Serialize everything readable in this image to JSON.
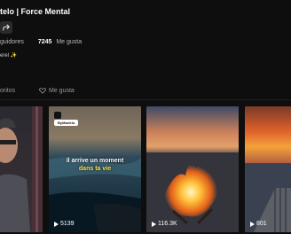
{
  "profile": {
    "title": "telo | Force Mental",
    "followers_label": "guidores",
    "likes_count": "7245",
    "likes_label": "Me gusta",
    "bio": "erel ✨"
  },
  "tabs": [
    {
      "label": "oritos",
      "icon": "bookmark-icon"
    },
    {
      "label": "Me gusta",
      "icon": "heart-icon"
    }
  ],
  "videos": [
    {
      "views": "",
      "theme": "person"
    },
    {
      "views": "5139",
      "theme": "ocean",
      "author_tag": "ByMartelo",
      "caption_line1": "il arrive un moment",
      "caption_line2": "dans ta vie"
    },
    {
      "views": "116.3K",
      "theme": "fire"
    },
    {
      "views": "801",
      "theme": "sunset"
    }
  ],
  "colors": {
    "background": "#0e0e0e",
    "caption_accent": "#ffe44f"
  }
}
